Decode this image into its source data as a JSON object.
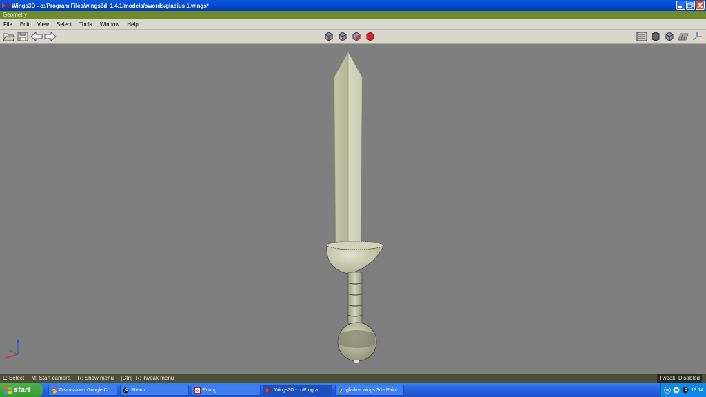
{
  "window": {
    "title": "Wings3D - c:/Program Files/wings3d_1.4.1/models/swords/gladius 1.wings*",
    "geometry_label": "Geometry"
  },
  "menu": [
    "File",
    "Edit",
    "View",
    "Select",
    "Tools",
    "Window",
    "Help"
  ],
  "toolbar": {
    "left_icons": [
      "open-file-icon",
      "save-icon",
      "undo-arrow-icon",
      "redo-arrow-icon"
    ],
    "selection_mode_icons": [
      "vertex-mode-icon",
      "edge-mode-icon",
      "face-mode-icon",
      "body-mode-icon"
    ],
    "right_icons": [
      "smooth-preview-icon",
      "shaded-view-icon",
      "wireframe-cube-icon",
      "ground-plane-icon",
      "axes-icon"
    ]
  },
  "status": {
    "hints": [
      "L: Select",
      "M: Start camera",
      "R: Show menu",
      "[Ctrl]+R: Tweak menu"
    ],
    "tweak": "Tweak: Disabled"
  },
  "taskbar": {
    "start_label": "start",
    "tasks": [
      {
        "label": "Discussion - Google C...",
        "icon": "chrome-icon",
        "active": false
      },
      {
        "label": "Steam",
        "icon": "steam-icon",
        "active": false
      },
      {
        "label": "Erlang",
        "icon": "erlang-icon",
        "active": false
      },
      {
        "label": "Wings3D - c:/Progra...",
        "icon": "wings3d-icon",
        "active": true
      },
      {
        "label": "gladius wings 3d - Paint",
        "icon": "paint-icon",
        "active": false
      }
    ],
    "clock": "13:14"
  },
  "colors": {
    "viewport_bg": "#7f7f7f",
    "blade": "#d6d9bd",
    "guard": "#cfd2b6",
    "title_bar": "#0a58e0",
    "geometry_bar": "#6e8b2f",
    "status_bar": "#4d4f38"
  }
}
